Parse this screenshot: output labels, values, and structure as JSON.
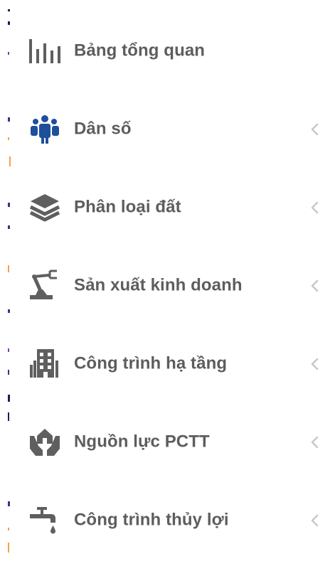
{
  "sidebar": {
    "items": [
      {
        "label": "Bảng tổng quan",
        "icon": "bar-chart-icon",
        "has_submenu": false
      },
      {
        "label": "Dân số",
        "icon": "people-group-icon",
        "has_submenu": true
      },
      {
        "label": "Phân loại đất",
        "icon": "layers-icon",
        "has_submenu": true
      },
      {
        "label": "Sản xuất kinh doanh",
        "icon": "industry-robot-arm-icon",
        "has_submenu": true
      },
      {
        "label": "Công trình hạ tầng",
        "icon": "building-icon",
        "has_submenu": true
      },
      {
        "label": "Nguồn lực PCTT",
        "icon": "hands-house-icon",
        "has_submenu": true
      },
      {
        "label": "Công trình thủy lợi",
        "icon": "water-faucet-icon",
        "has_submenu": true
      }
    ]
  },
  "colors": {
    "label_text": "#5d5d5d",
    "icon_gray": "#5f5f5f",
    "icon_blue": "#1e4f9a",
    "chevron": "#c4c9d0",
    "background": "#ffffff"
  }
}
